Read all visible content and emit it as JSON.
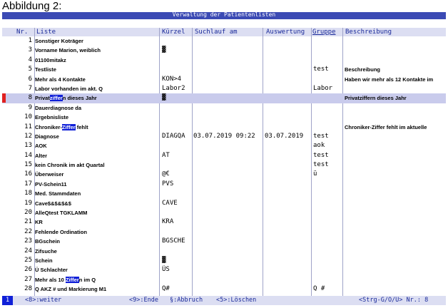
{
  "caption": "Abbildung 2:",
  "window_title": "Verwaltung der Patientenlisten",
  "columns": {
    "nr": "Nr.",
    "liste": "Liste",
    "kuerzel": "Kürzel",
    "suchlauf": "Suchlauf am",
    "auswertung": "Auswertung",
    "gruppe": "Gruppe",
    "beschreibung": "Beschreibung"
  },
  "rows": [
    {
      "nr": "1",
      "liste": "Sonstiger Koträger",
      "kuerzel": "",
      "suchlauf": "",
      "auswertung": "",
      "gruppe": "",
      "beschreibung": ""
    },
    {
      "nr": "3",
      "liste": "Vorname Marion, weiblich",
      "kuerzel": "▓",
      "suchlauf": "",
      "auswertung": "",
      "gruppe": "",
      "beschreibung": ""
    },
    {
      "nr": "4",
      "liste": "01100mitakz",
      "kuerzel": "",
      "suchlauf": "",
      "auswertung": "",
      "gruppe": "",
      "beschreibung": ""
    },
    {
      "nr": "5",
      "liste": "Testliste",
      "kuerzel": "",
      "suchlauf": "",
      "auswertung": "",
      "gruppe": "test",
      "beschreibung": "Beschreibung"
    },
    {
      "nr": "6",
      "liste": "Mehr als 4 Kontakte",
      "kuerzel": "KON>4",
      "suchlauf": "",
      "auswertung": "",
      "gruppe": "",
      "beschreibung": "Haben wir mehr als 12 Kontakte im"
    },
    {
      "nr": "7",
      "liste": "Labor vorhanden im akt. Q",
      "kuerzel": "Labor2",
      "suchlauf": "",
      "auswertung": "",
      "gruppe": "Labor",
      "beschreibung": ""
    },
    {
      "nr": "8",
      "liste_pre": "Privat",
      "liste_hl": "ziffer",
      "liste_post": "n dieses Jahr",
      "kuerzel": "▓",
      "suchlauf": "",
      "auswertung": "",
      "gruppe": "",
      "beschreibung": "Privatziffern dieses Jahr"
    },
    {
      "nr": "9",
      "liste": "Dauerdiagnose da",
      "kuerzel": "",
      "suchlauf": "",
      "auswertung": "",
      "gruppe": "",
      "beschreibung": ""
    },
    {
      "nr": "10",
      "liste": "Ergebnisliste",
      "kuerzel": "",
      "suchlauf": "",
      "auswertung": "",
      "gruppe": "",
      "beschreibung": ""
    },
    {
      "nr": "11",
      "liste_pre": "Chroniker-",
      "liste_hl": "Ziffer",
      "liste_post": " fehlt",
      "kuerzel": "",
      "suchlauf": "",
      "auswertung": "",
      "gruppe": "",
      "beschreibung": "Chroniker-Ziffer fehlt im aktuelle"
    },
    {
      "nr": "12",
      "liste": "Diagnose",
      "kuerzel": "DIAGQA",
      "suchlauf": "03.07.2019 09:22",
      "auswertung": "03.07.2019",
      "gruppe": "test",
      "beschreibung": ""
    },
    {
      "nr": "13",
      "liste": "AOK",
      "kuerzel": "",
      "suchlauf": "",
      "auswertung": "",
      "gruppe": "aok",
      "beschreibung": ""
    },
    {
      "nr": "14",
      "liste": "Alter",
      "kuerzel": "AT",
      "suchlauf": "",
      "auswertung": "",
      "gruppe": "test",
      "beschreibung": ""
    },
    {
      "nr": "15",
      "liste": "kein Chronik im akt Quartal",
      "kuerzel": "",
      "suchlauf": "",
      "auswertung": "",
      "gruppe": "test",
      "beschreibung": ""
    },
    {
      "nr": "16",
      "liste": "Überweiser",
      "kuerzel": "@€",
      "suchlauf": "",
      "auswertung": "",
      "gruppe": "ü",
      "beschreibung": ""
    },
    {
      "nr": "17",
      "liste": "PV-Schein11",
      "kuerzel": "PVS",
      "suchlauf": "",
      "auswertung": "",
      "gruppe": "",
      "beschreibung": ""
    },
    {
      "nr": "18",
      "liste": "Med. Stammdaten",
      "kuerzel": "",
      "suchlauf": "",
      "auswertung": "",
      "gruppe": "",
      "beschreibung": ""
    },
    {
      "nr": "19",
      "liste": "Cave$&$&$&$",
      "kuerzel": "CAVE",
      "suchlauf": "",
      "auswertung": "",
      "gruppe": "",
      "beschreibung": ""
    },
    {
      "nr": "20",
      "liste": "AlleQtest TGKLAMM",
      "kuerzel": "",
      "suchlauf": "",
      "auswertung": "",
      "gruppe": "",
      "beschreibung": ""
    },
    {
      "nr": "21",
      "liste": "KR",
      "kuerzel": "KRA",
      "suchlauf": "",
      "auswertung": "",
      "gruppe": "",
      "beschreibung": ""
    },
    {
      "nr": "22",
      "liste": "Fehlende Ordination",
      "kuerzel": "",
      "suchlauf": "",
      "auswertung": "",
      "gruppe": "",
      "beschreibung": ""
    },
    {
      "nr": "23",
      "liste": "BGschein",
      "kuerzel": "BGSCHE",
      "suchlauf": "",
      "auswertung": "",
      "gruppe": "",
      "beschreibung": ""
    },
    {
      "nr": "24",
      "liste": "Zifsuche",
      "kuerzel": "",
      "suchlauf": "",
      "auswertung": "",
      "gruppe": "",
      "beschreibung": ""
    },
    {
      "nr": "25",
      "liste": "Schein",
      "kuerzel": "▓",
      "suchlauf": "",
      "auswertung": "",
      "gruppe": "",
      "beschreibung": ""
    },
    {
      "nr": "26",
      "liste": "Ü Schlachter",
      "kuerzel": "ÜS",
      "suchlauf": "",
      "auswertung": "",
      "gruppe": "",
      "beschreibung": ""
    },
    {
      "nr": "27",
      "liste_pre": "Mehr als 10 ",
      "liste_hl": "Ziffer",
      "liste_post": "n im Q",
      "kuerzel": "",
      "suchlauf": "",
      "auswertung": "",
      "gruppe": "",
      "beschreibung": ""
    },
    {
      "nr": "28",
      "liste": "Q AKZ # und Markierung M1",
      "kuerzel": "Q#",
      "suchlauf": "",
      "auswertung": "",
      "gruppe": "Q #",
      "beschreibung": ""
    }
  ],
  "status": {
    "num": "1",
    "weiter": "<8>:weiter",
    "ende": "<9>:Ende",
    "abbruch": "§:Abbruch",
    "loeschen": "<5>:Löschen",
    "strg": "<Strg-G/O/U> Nr.: 8"
  },
  "colors": {
    "accent": "#1020d8",
    "header_bg": "#dcdef2",
    "selected_bg": "#c9cbec",
    "marker": "#e02020"
  }
}
